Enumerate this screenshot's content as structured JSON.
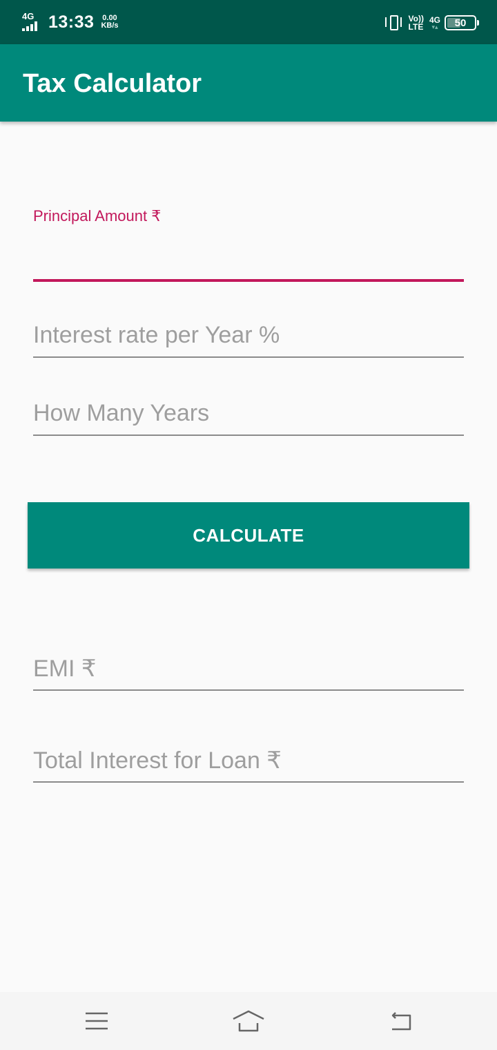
{
  "status_bar": {
    "network": "4G",
    "time": "13:33",
    "speed_value": "0.00",
    "speed_unit": "KB/s",
    "volte_top": "Vo))",
    "volte_bottom": "LTE",
    "network_right": "4G",
    "battery": "50",
    "battery_level": 0.5
  },
  "app_bar": {
    "title": "Tax Calculator"
  },
  "form": {
    "principal": {
      "label": "Principal Amount ₹",
      "value": ""
    },
    "interest": {
      "placeholder": "Interest rate per Year %"
    },
    "years": {
      "placeholder": "How Many Years"
    },
    "calculate_label": "CALCULATE",
    "emi": {
      "placeholder": "EMI ₹"
    },
    "total_interest": {
      "placeholder": "Total Interest for Loan ₹"
    }
  },
  "nav_bar": {
    "icons": [
      "menu-icon",
      "home-icon",
      "back-icon"
    ]
  },
  "colors": {
    "status_bar": "#00574b",
    "primary": "#00897b",
    "accent": "#c2185b",
    "background": "#fafafa"
  }
}
